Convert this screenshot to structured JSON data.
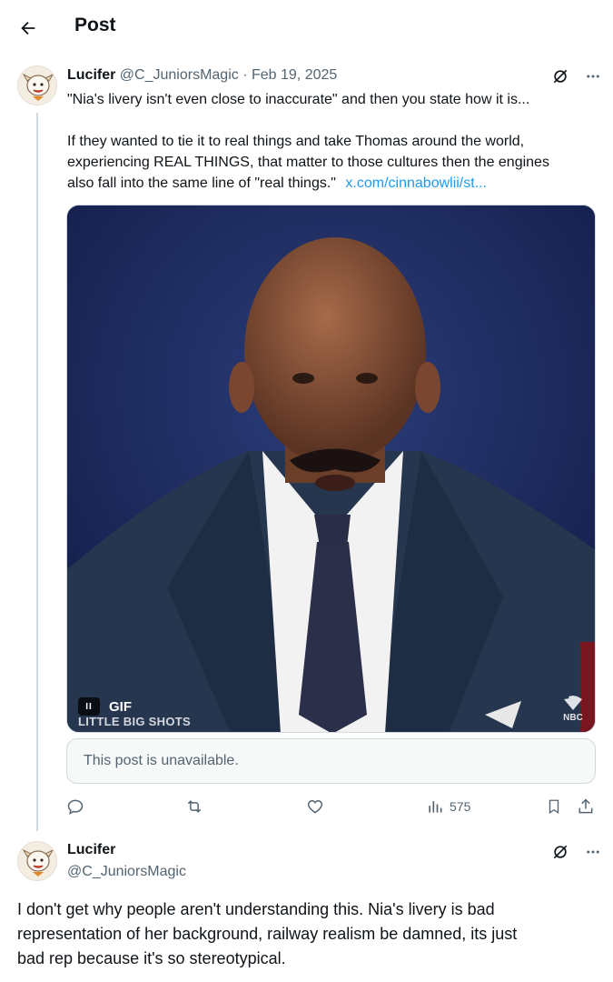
{
  "header": {
    "title": "Post",
    "back_icon": "arrow-left-icon"
  },
  "post1": {
    "author_name": "Lucifer",
    "handle": "@C_JuniorsMagic",
    "separator": "·",
    "date": "Feb 19, 2025",
    "text_line1": "\"Nia's livery isn't even close to inaccurate\" and then you state how it is...",
    "text_line2": "If they wanted to tie it to real things and take Thomas around the world,",
    "text_line3": "experiencing REAL THINGS, that matter to those cultures then the engines",
    "text_line4": "also fall into the same line of \"real things.\"",
    "link": "x.com/cinnabowlii/st...",
    "media": {
      "type": "GIF",
      "pause_label": "II",
      "gif_label": "GIF",
      "watermark": "LITTLE BIG SHOTS",
      "network": "NBC"
    },
    "quoted_unavailable": "This post is unavailable.",
    "views": "575",
    "icons": {
      "grok": "grok-slash-icon",
      "more": "more-dots-icon",
      "reply": "reply-icon",
      "retweet": "retweet-icon",
      "like": "heart-icon",
      "views": "views-chart-icon",
      "bookmark": "bookmark-icon",
      "share": "share-icon"
    }
  },
  "post2": {
    "author_name": "Lucifer",
    "handle": "@C_JuniorsMagic",
    "text_line1": "I don't get why people aren't understanding this. Nia's livery is bad",
    "text_line2": "representation of her background, railway realism be damned, its just",
    "text_line3": "bad rep because it's so stereotypical."
  },
  "colors": {
    "link": "#1d9bf0",
    "muted": "#536471",
    "border": "#cfd9de",
    "text": "#0f1419"
  }
}
